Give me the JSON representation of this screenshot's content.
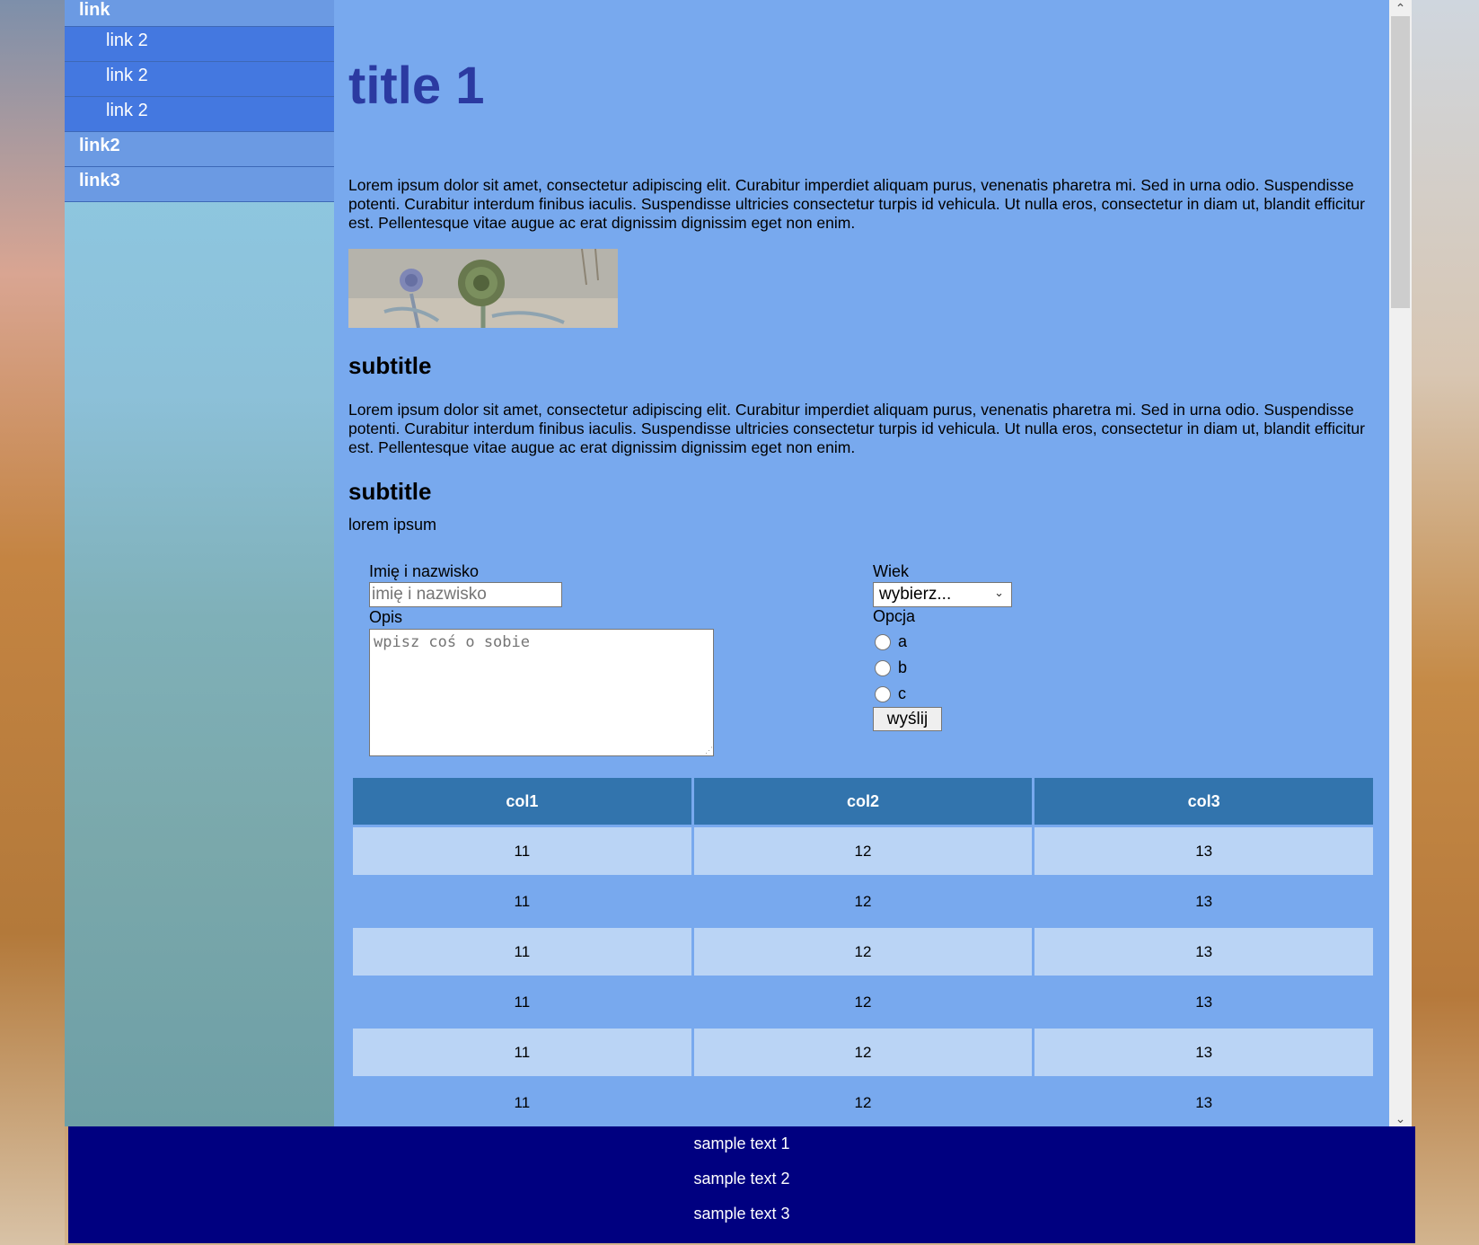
{
  "sidebar": {
    "items": [
      {
        "label": "link",
        "kind": "top"
      },
      {
        "label": "link 2",
        "kind": "sub"
      },
      {
        "label": "link 2",
        "kind": "sub"
      },
      {
        "label": "link 2",
        "kind": "sub"
      },
      {
        "label": "link2",
        "kind": "top"
      },
      {
        "label": "link3",
        "kind": "top"
      }
    ]
  },
  "main": {
    "title": "title 1",
    "paragraph1": "Lorem ipsum dolor sit amet, consectetur adipiscing elit. Curabitur imperdiet aliquam purus, venenatis pharetra mi. Sed in urna odio. Suspendisse potenti. Curabitur interdum finibus iaculis. Suspendisse ultricies consectetur turpis id vehicula. Ut nulla eros, consectetur in diam ut, blandit efficitur est. Pellentesque vitae augue ac erat dignissim dignissim eget non enim.",
    "subtitle1": "subtitle",
    "paragraph2": "Lorem ipsum dolor sit amet, consectetur adipiscing elit. Curabitur imperdiet aliquam purus, venenatis pharetra mi. Sed in urna odio. Suspendisse potenti. Curabitur interdum finibus iaculis. Suspendisse ultricies consectetur turpis id vehicula. Ut nulla eros, consectetur in diam ut, blandit efficitur est. Pellentesque vitae augue ac erat dignissim dignissim eget non enim.",
    "subtitle2": "subtitle",
    "small_text": "lorem ipsum"
  },
  "form": {
    "name_label": "Imię i nazwisko",
    "name_placeholder": "imię i nazwisko",
    "desc_label": "Opis",
    "desc_placeholder": "wpisz coś o sobie",
    "age_label": "Wiek",
    "age_selected": "wybierz...",
    "option_label": "Opcja",
    "options": [
      "a",
      "b",
      "c"
    ],
    "submit_label": "wyślij"
  },
  "table": {
    "headers": [
      "col1",
      "col2",
      "col3"
    ],
    "rows": [
      [
        "11",
        "12",
        "13"
      ],
      [
        "11",
        "12",
        "13"
      ],
      [
        "11",
        "12",
        "13"
      ],
      [
        "11",
        "12",
        "13"
      ],
      [
        "11",
        "12",
        "13"
      ],
      [
        "11",
        "12",
        "13"
      ]
    ]
  },
  "footer": {
    "lines": [
      "sample text 1",
      "sample text 2",
      "sample text 3"
    ]
  },
  "colors": {
    "main_bg": "#78a9ee",
    "title": "#2b3aa1",
    "table_header": "#3274ad",
    "table_row_alt": "#bad4f5",
    "footer_bg": "#000080",
    "nav_top": "#6b9ae3",
    "nav_sub": "#4478e0"
  }
}
